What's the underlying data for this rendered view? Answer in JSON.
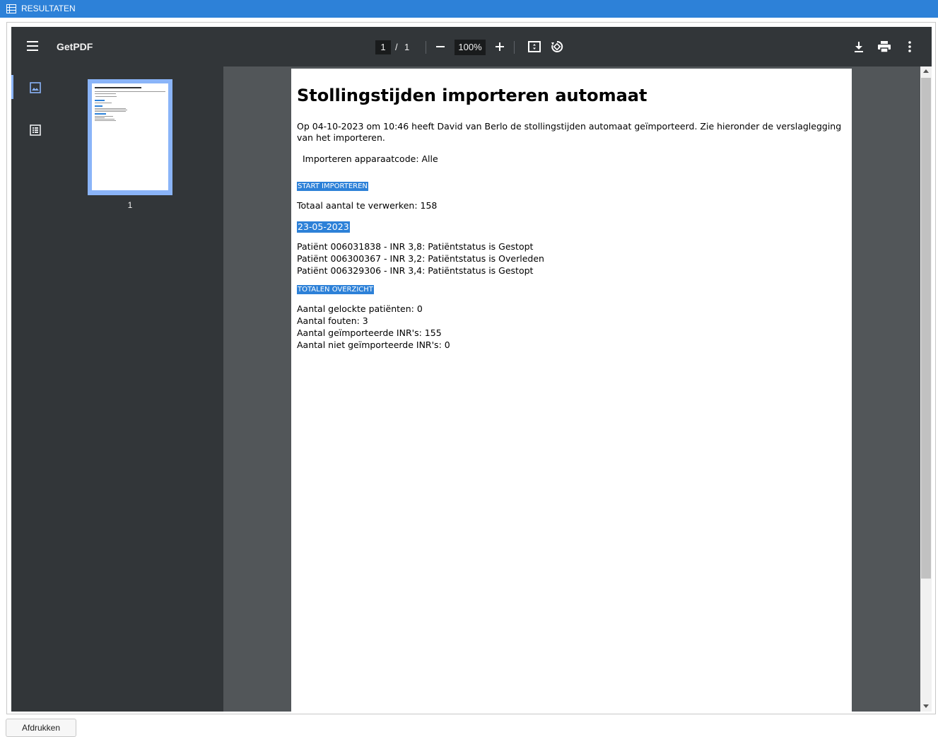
{
  "window": {
    "title": "RESULTATEN",
    "title_icon": "list-icon",
    "accent": "#2d81d8"
  },
  "viewer": {
    "doc_title": "GetPDF",
    "current_page": "1",
    "page_separator": "/",
    "total_pages": "1",
    "zoom": "100%",
    "thumbnail_label": "1",
    "icons": [
      "menu-icon",
      "zoom-out-icon",
      "zoom-in-icon",
      "fit-page-icon",
      "rotate-icon",
      "download-icon",
      "print-icon",
      "more-vert-icon",
      "thumbnails-icon",
      "outline-icon"
    ]
  },
  "pdf": {
    "heading": "Stollingstijden importeren automaat",
    "intro": "Op 04-10-2023 om 10:46 heeft David van Berlo de stollingstijden automaat geïmporteerd. Zie hieronder de verslaglegging van het importeren.",
    "device": "Importeren apparaatcode: Alle",
    "section_start": "START IMPORTEREN",
    "total_to_process": "Totaal aantal te verwerken: 158",
    "date": "23-05-2023",
    "patients": [
      "Patiënt 006031838 - INR 3,8: Patiëntstatus is Gestopt",
      "Patiënt 006300367 - INR 3,2: Patiëntstatus is Overleden",
      "Patiënt 006329306 - INR 3,4: Patiëntstatus is Gestopt"
    ],
    "section_totals": "TOTALEN OVERZICHT",
    "totals": [
      "Aantal gelockte patiënten: 0",
      "Aantal fouten: 3",
      "Aantal geïmporteerde INR's: 155",
      "Aantal niet geïmporteerde INR's: 0"
    ]
  },
  "footer": {
    "print_label": "Afdrukken"
  }
}
